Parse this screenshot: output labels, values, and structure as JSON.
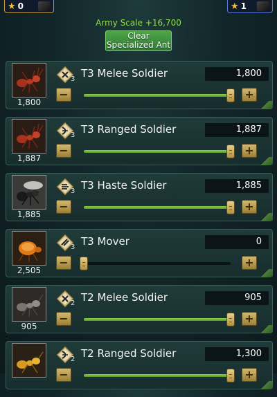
{
  "hud": {
    "left_value": "0",
    "right_value": "1"
  },
  "army_scale": "Army Scale +16,700",
  "clear_button": {
    "line1": "Clear",
    "line2": "Specialized Ant"
  },
  "troops": [
    {
      "name": "T3 Melee Soldier",
      "tier": "3",
      "quantity": "1,800",
      "owned": "1,800",
      "fill": 1.0,
      "icon": "melee-soldier-icon",
      "art": "red-ant"
    },
    {
      "name": "T3 Ranged Soldier",
      "tier": "3",
      "quantity": "1,887",
      "owned": "1,887",
      "fill": 1.0,
      "icon": "ranged-soldier-icon",
      "art": "red-ant"
    },
    {
      "name": "T3 Haste Soldier",
      "tier": "3",
      "quantity": "1,885",
      "owned": "1,885",
      "fill": 1.0,
      "icon": "haste-soldier-icon",
      "art": "flying-ant"
    },
    {
      "name": "T3 Mover",
      "tier": "3",
      "quantity": "0",
      "owned": "2,505",
      "fill": 0.0,
      "icon": "mover-icon",
      "art": "mover-ant"
    },
    {
      "name": "T2 Melee Soldier",
      "tier": "2",
      "quantity": "905",
      "owned": "905",
      "fill": 1.0,
      "icon": "melee-soldier-icon",
      "art": "gray-ant"
    },
    {
      "name": "T2 Ranged Soldier",
      "tier": "2",
      "quantity": "1,300",
      "owned": "",
      "fill": 1.0,
      "icon": "ranged-soldier-icon",
      "art": "gold-ant"
    }
  ],
  "colors": {
    "accent_green": "#8fe04a",
    "button_gold": "#c9a955",
    "background": "#12262a"
  }
}
